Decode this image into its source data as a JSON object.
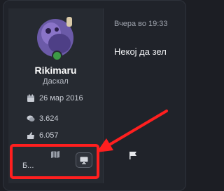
{
  "user": {
    "name": "Rikimaru",
    "title": "Даскал",
    "joined": "26 мар 2016",
    "messages": "3.624",
    "reactions": "6.057",
    "truncated_label": "Б..."
  },
  "post": {
    "date": "Вчера во 19:33",
    "body": "Некој да зел"
  },
  "colors": {
    "online": "#3d9a46",
    "highlight": "#ff1f1f",
    "background": "#1c1e24"
  },
  "icons": [
    "calendar-icon",
    "comments-icon",
    "thumbs-up-icon",
    "map-icon",
    "monitor-icon",
    "flag-icon"
  ]
}
